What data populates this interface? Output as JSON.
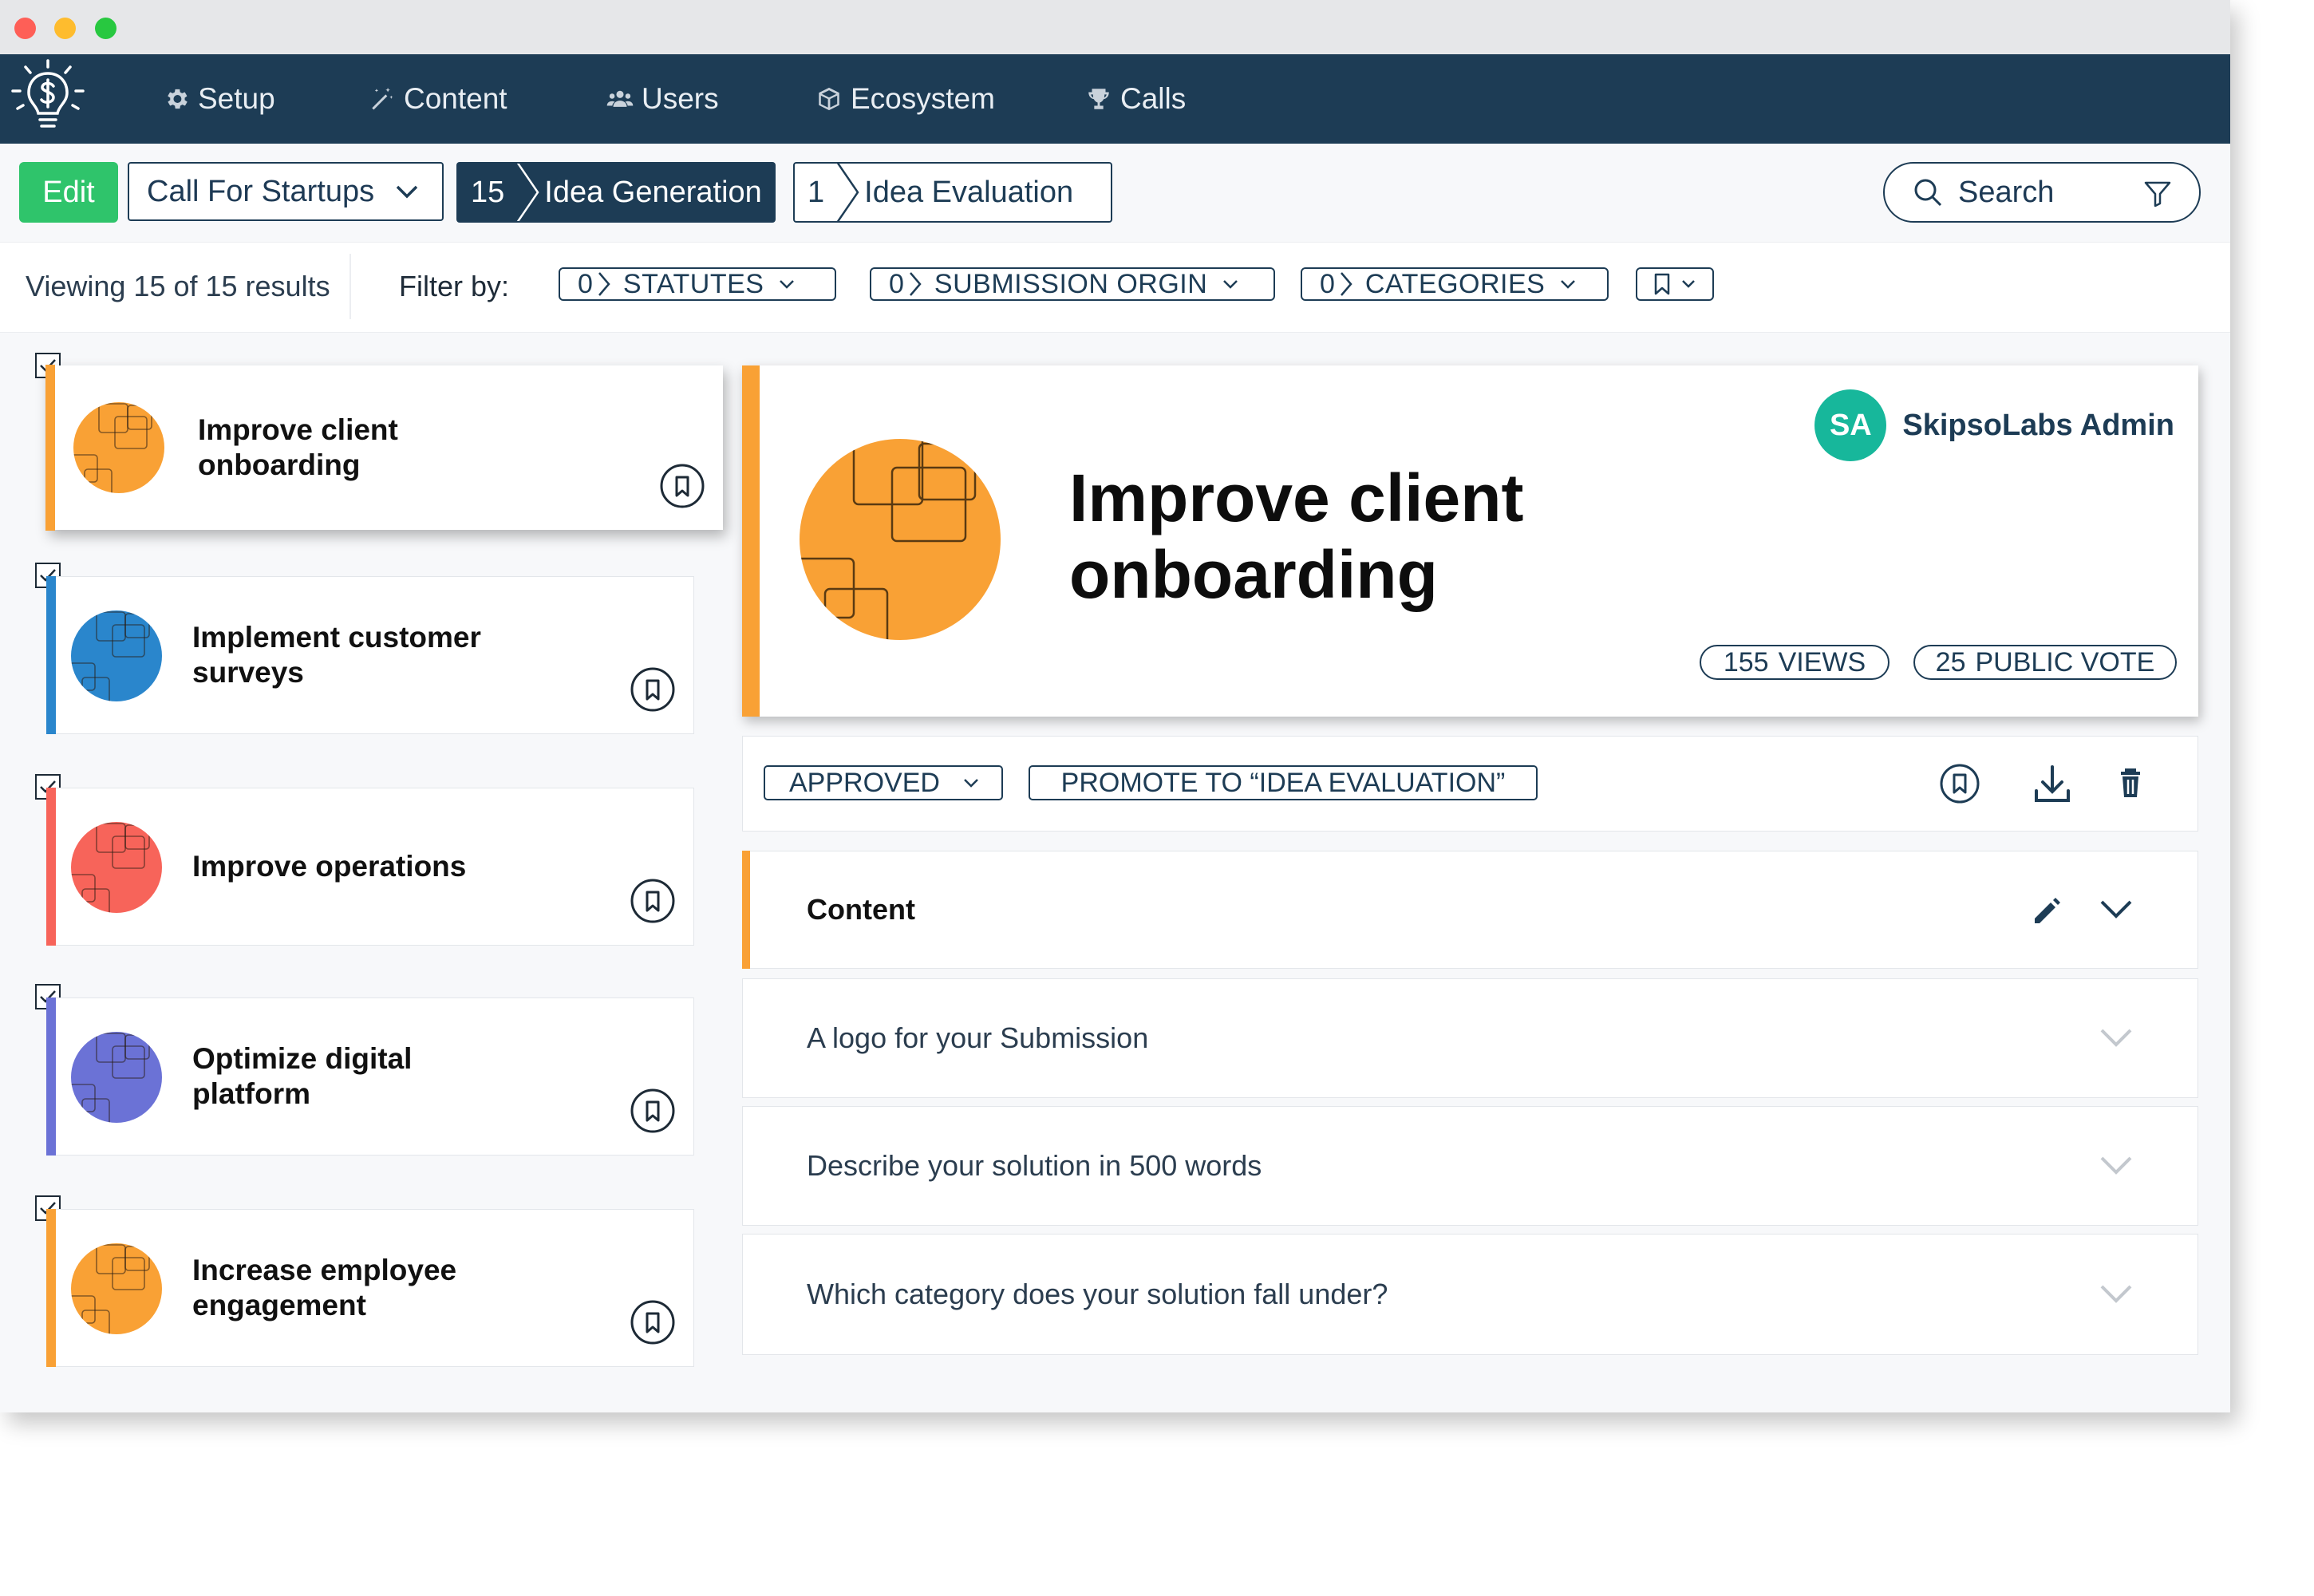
{
  "colors": {
    "navy": "#1d3c55",
    "edit_green": "#2fc46b",
    "orange": "#f9a135",
    "blue": "#2a86cc",
    "coral": "#f7645a",
    "indigo": "#6b72d6",
    "teal": "#17b79b"
  },
  "nav": {
    "items": [
      {
        "label": "Setup",
        "icon": "gear-icon"
      },
      {
        "label": "Content",
        "icon": "magic-wand-icon"
      },
      {
        "label": "Users",
        "icon": "users-icon"
      },
      {
        "label": "Ecosystem",
        "icon": "cube-icon"
      },
      {
        "label": "Calls",
        "icon": "trophy-icon"
      }
    ]
  },
  "toolbar": {
    "edit_label": "Edit",
    "call_select": "Call For Startups",
    "stages": [
      {
        "count": "15",
        "label": "Idea Generation",
        "active": true
      },
      {
        "count": "1",
        "label": "Idea Evaluation",
        "active": false
      }
    ],
    "search_placeholder": "Search"
  },
  "filters": {
    "viewing": "Viewing 15 of 15 results",
    "filter_by": "Filter by:",
    "chips": [
      {
        "count": "0",
        "label": "STATUTES"
      },
      {
        "count": "0",
        "label": "SUBMISSION ORGIN"
      },
      {
        "count": "0",
        "label": "CATEGORIES"
      }
    ]
  },
  "ideas": [
    {
      "title": "Improve client onboarding",
      "color": "#f9a135",
      "selected": true
    },
    {
      "title": "Implement customer surveys",
      "color": "#2a86cc",
      "selected": false
    },
    {
      "title": "Improve operations",
      "color": "#f7645a",
      "selected": false
    },
    {
      "title": "Optimize digital platform",
      "color": "#6b72d6",
      "selected": false
    },
    {
      "title": "Increase employee engagement",
      "color": "#f9a135",
      "selected": false
    }
  ],
  "detail": {
    "title": "Improve client onboarding",
    "admin_initials": "SA",
    "admin_name": "SkipsoLabs Admin",
    "views_count": "155",
    "views_label": "VIEWS",
    "votes_count": "25",
    "votes_label": "PUBLIC VOTE",
    "status": "APPROVED",
    "promote_label": "PROMOTE TO “IDEA EVALUATION”",
    "sections": [
      {
        "label": "Content"
      },
      {
        "label": "A logo for your Submission"
      },
      {
        "label": "Describe your solution in 500 words"
      },
      {
        "label": "Which category does your solution fall under?"
      }
    ]
  }
}
